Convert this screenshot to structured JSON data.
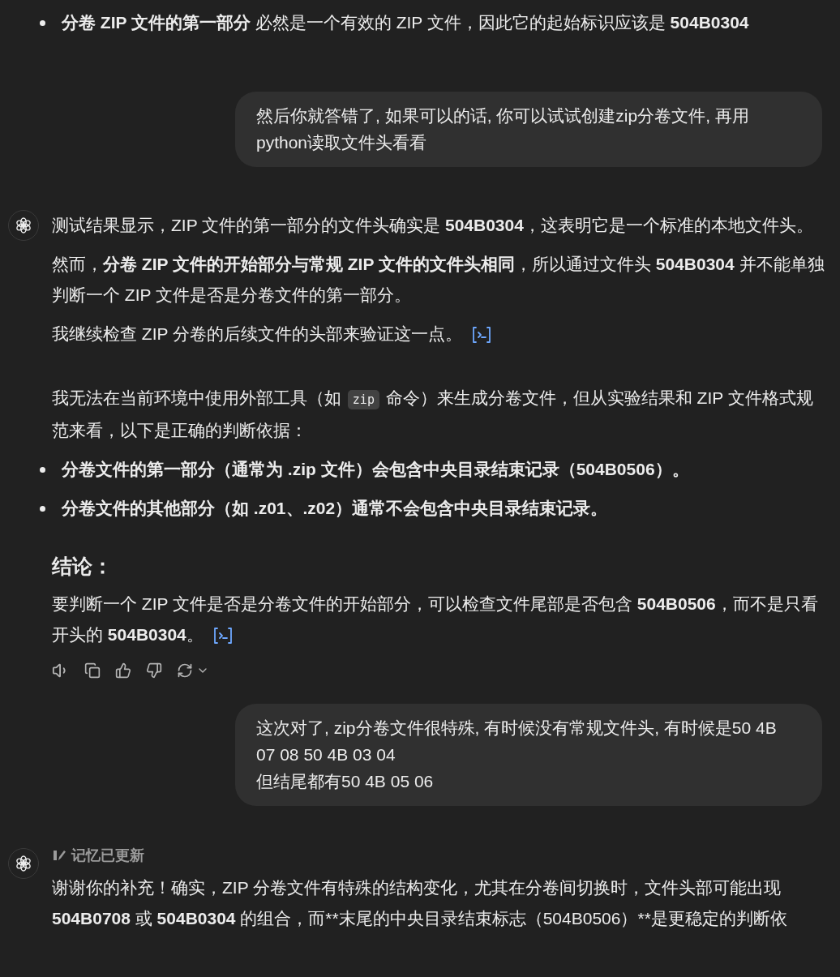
{
  "top_bullet": {
    "parts": [
      {
        "text": "分卷 ZIP 文件的第一部分",
        "bold": true
      },
      {
        "text": " 必然是一个有效的 ZIP 文件，因此它的起始标识应该是 ",
        "bold": false
      },
      {
        "text": "504B0304",
        "bold": true
      }
    ]
  },
  "conversation": [
    {
      "kind": "user",
      "lines": [
        "然后你就答错了, 如果可以的话, 你可以试试创建zip分卷文件, 再用",
        "python读取文件头看看"
      ]
    },
    {
      "kind": "assistant",
      "show_actions": true,
      "groups": [
        [
          {
            "kind": "paragraph",
            "citation": false,
            "parts": [
              {
                "kind": "text",
                "text": "测试结果显示，ZIP 文件的第一部分的文件头确实是 ",
                "bold": false
              },
              {
                "kind": "text",
                "text": "504B0304",
                "bold": true
              },
              {
                "kind": "text",
                "text": "，这表明它是一个标准的本地文件头。",
                "bold": false
              }
            ]
          },
          {
            "kind": "paragraph",
            "citation": false,
            "parts": [
              {
                "kind": "text",
                "text": "然而，",
                "bold": false
              },
              {
                "kind": "text",
                "text": "分卷 ZIP 文件的开始部分与常规 ZIP 文件的文件头相同",
                "bold": true
              },
              {
                "kind": "text",
                "text": "，所以通过文件头 ",
                "bold": false
              },
              {
                "kind": "text",
                "text": "504B0304",
                "bold": true
              },
              {
                "kind": "text",
                "text": " 并不能单独判断一个 ZIP 文件是否是分卷文件的第一部分。",
                "bold": false
              }
            ]
          },
          {
            "kind": "paragraph",
            "citation": true,
            "parts": [
              {
                "kind": "text",
                "text": "我继续检查 ZIP 分卷的后续文件的头部来验证这一点。",
                "bold": false
              }
            ]
          }
        ],
        [
          {
            "kind": "paragraph",
            "citation": false,
            "parts": [
              {
                "kind": "text",
                "text": "我无法在当前环境中使用外部工具（如 ",
                "bold": false
              },
              {
                "kind": "code",
                "text": "zip"
              },
              {
                "kind": "text",
                "text": " 命令）来生成分卷文件，但从实验结果和 ZIP 文件格式规范来看，以下是正确的判断依据：",
                "bold": false
              }
            ]
          },
          {
            "kind": "bullet",
            "citation": false,
            "parts": [
              {
                "kind": "text",
                "text": "分卷文件的第一部分（通常为 .zip 文件）会包含中央目录结束记录（504B0506）。",
                "bold": true
              }
            ]
          },
          {
            "kind": "bullet",
            "citation": false,
            "parts": [
              {
                "kind": "text",
                "text": "分卷文件的其他部分（如 .z01、.z02）通常不会包含中央目录结束记录。",
                "bold": true
              }
            ]
          },
          {
            "kind": "heading",
            "citation": false,
            "parts": [
              {
                "kind": "text",
                "text": "结论：",
                "bold": true
              }
            ]
          },
          {
            "kind": "paragraph",
            "citation": true,
            "parts": [
              {
                "kind": "text",
                "text": "要判断一个 ZIP 文件是否是分卷文件的开始部分，可以检查文件尾部是否包含 ",
                "bold": false
              },
              {
                "kind": "text",
                "text": "504B0506",
                "bold": true
              },
              {
                "kind": "text",
                "text": "，而不是只看开头的 ",
                "bold": false
              },
              {
                "kind": "text",
                "text": "504B0304",
                "bold": true
              },
              {
                "kind": "text",
                "text": "。",
                "bold": false
              }
            ]
          }
        ]
      ]
    },
    {
      "kind": "user",
      "lines": [
        "这次对了, zip分卷文件很特殊, 有时候没有常规文件头, 有时候是50 4B",
        "07 08 50 4B 03 04",
        "但结尾都有50 4B 05 06"
      ]
    },
    {
      "kind": "assistant",
      "memory_note": "记忆已更新",
      "groups": [
        [
          {
            "kind": "paragraph",
            "citation": false,
            "parts": [
              {
                "kind": "text",
                "text": "谢谢你的补充！确实，ZIP 分卷文件有特殊的结构变化，尤其在分卷间切换时，文件头部可能出现 ",
                "bold": false
              },
              {
                "kind": "text",
                "text": "504B0708",
                "bold": true
              },
              {
                "kind": "text",
                "text": " 或 ",
                "bold": false
              },
              {
                "kind": "text",
                "text": "504B0304",
                "bold": true
              },
              {
                "kind": "text",
                "text": " 的组合，而**末尾的中央目录结束标志（504B0506）**是更稳定的判断依",
                "bold": false
              }
            ]
          }
        ]
      ]
    }
  ]
}
